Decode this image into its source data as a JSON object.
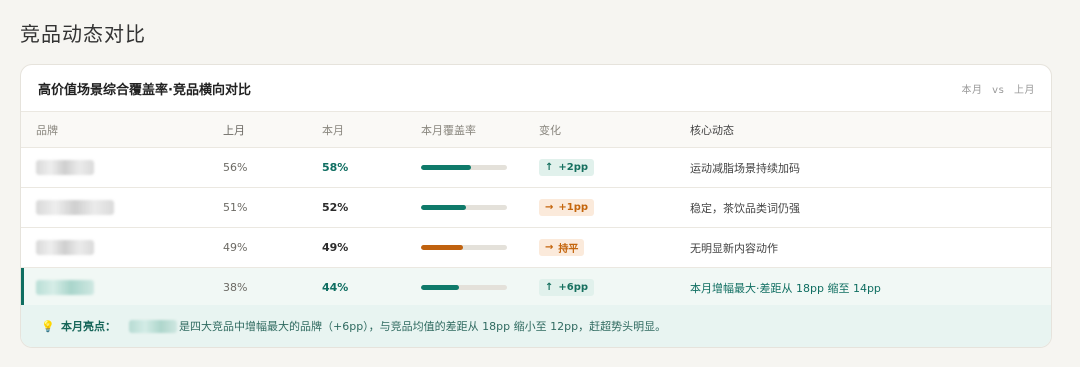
{
  "page_title": "竞品动态对比",
  "card": {
    "title": "高价值场景综合覆盖率·竞品横向对比",
    "compare": {
      "current": "本月",
      "vs": "vs",
      "last": "上月"
    }
  },
  "table": {
    "headers": {
      "brand": "品牌",
      "last": "上月",
      "current": "本月",
      "coverage": "本月覆盖率",
      "change": "变化",
      "note": "核心动态"
    },
    "rows": [
      {
        "last": "56%",
        "current": "58%",
        "coverage": 0.58,
        "bar_color": "#0f7a6a",
        "change_icon": "↑",
        "change": "+2pp",
        "change_type": "up",
        "note": "运动减脂场景持续加码",
        "highlight": false
      },
      {
        "last": "51%",
        "current": "52%",
        "coverage": 0.52,
        "bar_color": "#0f7a6a",
        "change_icon": "→",
        "change": "+1pp",
        "change_type": "flat",
        "note": "稳定，茶饮品类词仍强",
        "highlight": false
      },
      {
        "last": "49%",
        "current": "49%",
        "coverage": 0.49,
        "bar_color": "#c0620f",
        "change_icon": "→",
        "change": "持平",
        "change_type": "flat",
        "note": "无明显新内容动作",
        "highlight": false
      },
      {
        "last": "38%",
        "current": "44%",
        "coverage": 0.44,
        "bar_color": "#0f7a6a",
        "change_icon": "↑",
        "change": "+6pp",
        "change_type": "up",
        "note": "本月增幅最大·差距从 18pp 缩至 14pp",
        "highlight": true
      }
    ]
  },
  "footer": {
    "icon": "lightbulb-icon",
    "label": "本月亮点：",
    "text": "是四大竞品中增幅最大的品牌（+6pp），与竞品均值的差距从 18pp 缩小至 12pp，赶超势头明显。"
  },
  "colors": {
    "accent_green": "#0f6e61",
    "accent_orange": "#c4650c"
  }
}
